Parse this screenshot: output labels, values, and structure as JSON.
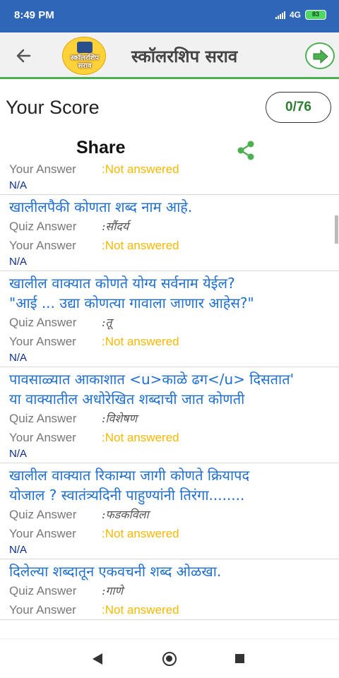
{
  "status_bar": {
    "time": "8:49 PM",
    "network": "4G",
    "battery": "83"
  },
  "app_bar": {
    "title": "स्कॉलरशिप सराव",
    "logo_text": "स्कॉलरशिप सराव"
  },
  "score": {
    "label": "Your Score",
    "value": "0/76",
    "share_label": "Share"
  },
  "labels": {
    "quiz_answer": "Quiz Answer",
    "your_answer": "Your Answer"
  },
  "partial_top": {
    "your_answer_label": "Your Answer",
    "your_answer_value": ":Not answered",
    "na": "N/A"
  },
  "questions": [
    {
      "question_line1": "खालीलपैकी कोणता शब्द नाम आहे.",
      "question_line2": "",
      "quiz_answer_label": "Quiz Answer",
      "quiz_answer_value": ":सौंदर्य",
      "your_answer_label": "Your Answer",
      "your_answer_value": ":Not answered",
      "na": "N/A"
    },
    {
      "question_line1": "खालील वाक्यात कोणते योग्य सर्वनाम येईल?",
      "question_line2": "\"आई ... उद्या कोणत्या गावाला जाणार आहेस?\"",
      "quiz_answer_label": "Quiz Answer",
      "quiz_answer_value": ":तू",
      "your_answer_label": "Your Answer",
      "your_answer_value": ":Not answered",
      "na": "N/A"
    },
    {
      "question_line1": "पावसाळ्यात आकाशात <u>काळे ढग</u> दिसतात'",
      "question_line2": "या वाक्यातील अधोरेखित शब्दाची जात कोणती",
      "quiz_answer_label": "Quiz Answer",
      "quiz_answer_value": ":विशेषण",
      "your_answer_label": "Your Answer",
      "your_answer_value": ":Not answered",
      "na": "N/A"
    },
    {
      "question_line1": "खालील वाक्यात रिकाम्या जागी कोणते क्रियापद",
      "question_line2": "योजाल ?  स्वातंत्र्यदिनी पाहुण्यांनी तिरंगा........",
      "quiz_answer_label": "Quiz Answer",
      "quiz_answer_value": ":फडकविला",
      "your_answer_label": "Your Answer",
      "your_answer_value": ":Not answered",
      "na": "N/A"
    },
    {
      "question_line1": "दिलेल्या शब्दातून एकवचनी शब्द ओळखा.",
      "question_line2": "",
      "quiz_answer_label": "Quiz Answer",
      "quiz_answer_value": ":गाणे",
      "your_answer_label": "Your Answer",
      "your_answer_value": ":Not answered",
      "na": ""
    }
  ],
  "colors": {
    "status_bar": "#2f66b8",
    "accent_green": "#4caf50",
    "question_blue": "#1e6fd0",
    "not_answered": "#f5b800",
    "score_green": "#2e7d32"
  },
  "icons": {
    "back": "arrow-left-icon",
    "next": "arrow-right-icon",
    "share": "share-icon"
  }
}
